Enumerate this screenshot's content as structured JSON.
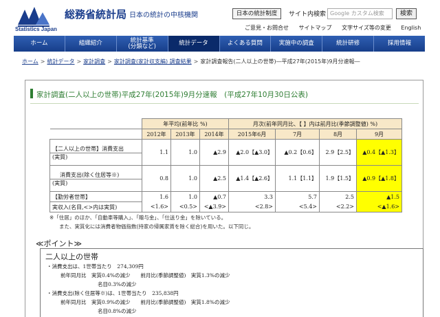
{
  "header": {
    "org_name": "総務省統計局",
    "logo_en": "Statistics Japan",
    "tagline": "日本の統計の中核機関",
    "nihon_button": "日本の統計制度",
    "search_label": "サイト内検索",
    "search_placeholder": "Google カスタム検索",
    "search_button": "検索",
    "util_links": [
      "ご意見・お問合せ",
      "サイトマップ",
      "文字サイズ等の変更",
      "English"
    ]
  },
  "nav": {
    "items": [
      {
        "label": "ホーム"
      },
      {
        "label": "組織紹介"
      },
      {
        "label": "統計基準\n(分類など)"
      },
      {
        "label": "統計データ"
      },
      {
        "label": "よくある質問"
      },
      {
        "label": "実施中の調査"
      },
      {
        "label": "統計研修"
      },
      {
        "label": "採用情報"
      }
    ],
    "active_index": 3
  },
  "breadcrumb": {
    "links": [
      "ホーム",
      "統計データ",
      "家計調査",
      "家計調査(家計収支編) 調査結果"
    ],
    "current": "家計調査報告(二人以上の世帯)―平成27年(2015年)9月分速報―"
  },
  "main": {
    "title": "家計調査(二人以上の世帯)平成27年(2015年)9月分速報　(平成27年10月30日公表)"
  },
  "table": {
    "group_annual": "年平均(前年比 %)",
    "group_monthly": "月次(前年同月比、【 】内は前月比(季節調整値) %)",
    "columns": [
      "2012年",
      "2013年",
      "2014年",
      "2015年6月",
      "7月",
      "8月",
      "9月"
    ],
    "rows": [
      {
        "label": "【二人以上の世帯】消費支出",
        "sublabel": "(実質)",
        "values": [
          "1.1",
          "1.0",
          "▲2.9",
          "▲2.0【▲3.0】",
          "▲0.2【0.6】",
          "2.9【2.5】",
          "▲0.4【▲1.3】"
        ]
      },
      {
        "label": "消費支出(除く住居等※)",
        "sublabel": "(実質)",
        "values": [
          "0.8",
          "1.0",
          "▲2.5",
          "▲1.4【▲2.6】",
          "1.1【1.1】",
          "1.9【1.5】",
          "▲0.9【▲1.8】"
        ]
      },
      {
        "label": "【勤労者世帯】",
        "sublabel": "実収入(名目,<>内は実質)",
        "values": [
          "1.6",
          "1.0",
          "▲0.7",
          "3.3",
          "5.7",
          "2.5",
          "▲1.5"
        ],
        "values_real": [
          "<1.6>",
          "<0.5>",
          "<▲3.9>",
          "<2.8>",
          "<5.4>",
          "<2.2>",
          "<▲1.6>"
        ]
      }
    ]
  },
  "notes": {
    "note1": "※「住居」のほか、「自動車等購入」、「贈与金」、「仕送り金」を除いている。",
    "note2": "また、実質化には消費者物価指数(持家の帰属家賃を除く総合)を用いた。以下同じ。"
  },
  "point": {
    "label": "≪ポイント≫",
    "heading": "二人以上の世帯",
    "lines": [
      "・消費支出は、1世帯当たり　274,309円",
      "前年同月比　実質0.4%の減少　　前月比(季節調整値)　実質1.3%の減少",
      "名目0.3%の減少",
      "・消費支出(除く住居等※)は、1世帯当たり　235,838円",
      "前年同月比　実質0.9%の減少　　前月比(季節調整値)　実質1.8%の減少",
      "名目0.8%の減少"
    ]
  },
  "colors": {
    "nav": "#1f4a9c",
    "title_green": "#2e7d32",
    "highlight": "#ffff00",
    "header_cell": "#f8e8c8"
  }
}
